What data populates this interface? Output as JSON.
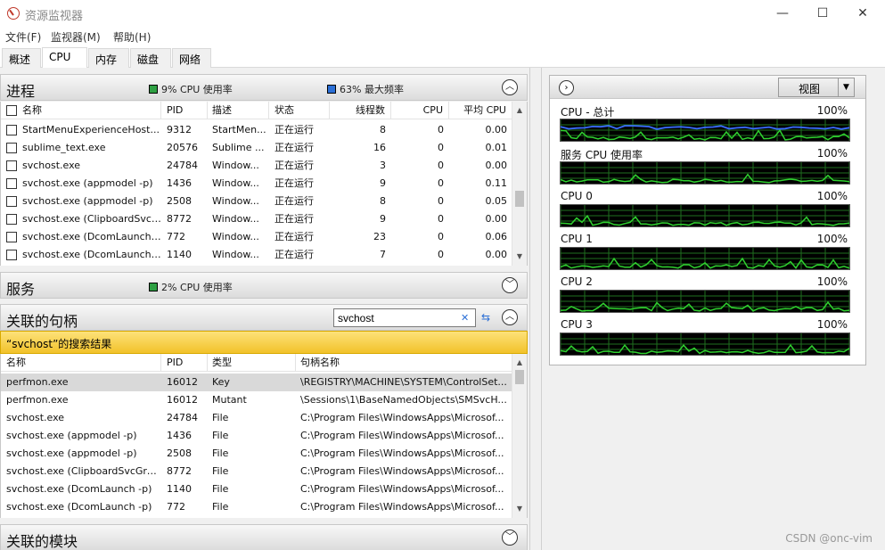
{
  "window": {
    "title": "资源监视器",
    "min_glyph": "—",
    "max_glyph": "☐",
    "close_glyph": "✕"
  },
  "menu": [
    "文件(F)",
    "监视器(M)",
    "帮助(H)"
  ],
  "tabs": [
    "概述",
    "CPU",
    "内存",
    "磁盘",
    "网络"
  ],
  "active_tab": "CPU",
  "processes": {
    "title": "进程",
    "cpu_usage": "9% CPU 使用率",
    "max_freq": "63% 最大频率",
    "columns": [
      "名称",
      "PID",
      "描述",
      "状态",
      "线程数",
      "CPU",
      "平均 CPU"
    ],
    "rows": [
      [
        "StartMenuExperienceHost...",
        "9312",
        "StartMen...",
        "正在运行",
        "8",
        "0",
        "0.00"
      ],
      [
        "sublime_text.exe",
        "20576",
        "Sublime ...",
        "正在运行",
        "16",
        "0",
        "0.01"
      ],
      [
        "svchost.exe",
        "24784",
        "Window...",
        "正在运行",
        "3",
        "0",
        "0.00"
      ],
      [
        "svchost.exe (appmodel -p)",
        "1436",
        "Window...",
        "正在运行",
        "9",
        "0",
        "0.11"
      ],
      [
        "svchost.exe (appmodel -p)",
        "2508",
        "Window...",
        "正在运行",
        "8",
        "0",
        "0.05"
      ],
      [
        "svchost.exe (ClipboardSvcG...",
        "8772",
        "Window...",
        "正在运行",
        "9",
        "0",
        "0.00"
      ],
      [
        "svchost.exe (DcomLaunch ...",
        "772",
        "Window...",
        "正在运行",
        "23",
        "0",
        "0.06"
      ],
      [
        "svchost.exe (DcomLaunch ...",
        "1140",
        "Window...",
        "正在运行",
        "7",
        "0",
        "0.00"
      ]
    ]
  },
  "services": {
    "title": "服务",
    "cpu_usage": "2% CPU 使用率"
  },
  "handles": {
    "title": "关联的句柄",
    "search_value": "svchost",
    "result_label": "“svchost”的搜索结果",
    "columns": [
      "名称",
      "PID",
      "类型",
      "句柄名称"
    ],
    "rows": [
      [
        "perfmon.exe",
        "16012",
        "Key",
        "\\REGISTRY\\MACHINE\\SYSTEM\\ControlSet..."
      ],
      [
        "perfmon.exe",
        "16012",
        "Mutant",
        "\\Sessions\\1\\BaseNamedObjects\\SMSvcH..."
      ],
      [
        "svchost.exe",
        "24784",
        "File",
        "C:\\Program Files\\WindowsApps\\Microsof..."
      ],
      [
        "svchost.exe (appmodel -p)",
        "1436",
        "File",
        "C:\\Program Files\\WindowsApps\\Microsof..."
      ],
      [
        "svchost.exe (appmodel -p)",
        "2508",
        "File",
        "C:\\Program Files\\WindowsApps\\Microsof..."
      ],
      [
        "svchost.exe (ClipboardSvcGro...",
        "8772",
        "File",
        "C:\\Program Files\\WindowsApps\\Microsof..."
      ],
      [
        "svchost.exe (DcomLaunch -p)",
        "1140",
        "File",
        "C:\\Program Files\\WindowsApps\\Microsof..."
      ],
      [
        "svchost.exe (DcomLaunch -p)",
        "772",
        "File",
        "C:\\Program Files\\WindowsApps\\Microsof..."
      ]
    ]
  },
  "modules": {
    "title": "关联的模块"
  },
  "graphs_panel": {
    "view_label": "视图",
    "graphs": [
      {
        "label": "CPU - 总计",
        "pct": "100%",
        "has_blue": true
      },
      {
        "label": "服务 CPU 使用率",
        "pct": "100%",
        "has_blue": false
      },
      {
        "label": "CPU 0",
        "pct": "100%",
        "has_blue": false
      },
      {
        "label": "CPU 1",
        "pct": "100%",
        "has_blue": false
      },
      {
        "label": "CPU 2",
        "pct": "100%",
        "has_blue": false
      },
      {
        "label": "CPU 3",
        "pct": "100%",
        "has_blue": false
      }
    ]
  },
  "colors": {
    "graph_green": "#2fd12f",
    "graph_blue": "#3a6cff",
    "grid": "#1f6f1f"
  },
  "watermark": "CSDN @onc-vim"
}
